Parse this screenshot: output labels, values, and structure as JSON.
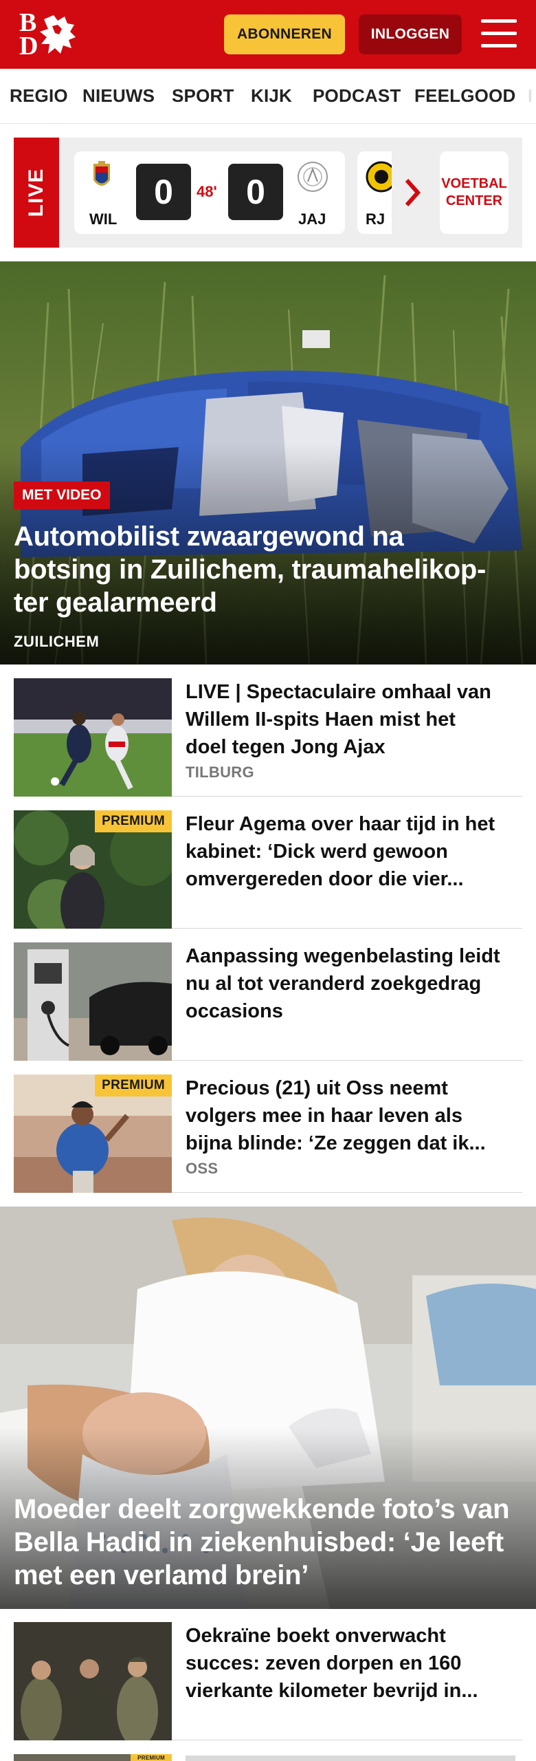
{
  "header": {
    "logo_letter_top": "B",
    "logo_letter_bottom": "D",
    "subscribe_label": "ABONNEREN",
    "login_label": "INLOGGEN",
    "menu_icon": "hamburger-icon",
    "brand_color": "#d10a11",
    "subscribe_color": "#f8c437"
  },
  "nav": {
    "items": [
      "REGIO",
      "NIEUWS",
      "SPORT",
      "KIJK",
      "PODCAST",
      "FEELGOOD",
      "I"
    ]
  },
  "live": {
    "label": "LIVE",
    "match": {
      "home_code": "WIL",
      "home_score": "0",
      "minute": "48'",
      "away_score": "0",
      "away_code": "JAJ"
    },
    "next_team_code": "RJ",
    "center_label_line1": "VOETBAL",
    "center_label_line2": "CENTER"
  },
  "hero": {
    "badge": "MET VIDEO",
    "title_lines": [
      "Automobilist zwaargewond na",
      "botsing in Zuilichem, traumahelikop-",
      "ter gealarmeerd"
    ],
    "location": "ZUILICHEM"
  },
  "articles": [
    {
      "title_lines": [
        "LIVE | Spectaculaire omhaal van",
        "Willem II-spits Haen mist het",
        "doel tegen Jong Ajax"
      ],
      "location": "TILBURG",
      "premium": ""
    },
    {
      "title_lines": [
        "Fleur Agema over haar tijd in het",
        "kabinet: ‘Dick werd gewoon",
        "omvergereden door die vier..."
      ],
      "location": "",
      "premium": "PREMIUM"
    },
    {
      "title_lines": [
        "Aanpassing wegenbelasting leidt",
        "nu al tot veranderd zoekgedrag",
        "occasions"
      ],
      "location": "",
      "premium": ""
    },
    {
      "title_lines": [
        "Precious (21) uit Oss neemt",
        "volgers mee in haar leven als",
        "bijna blinde: ‘Ze zeggen dat ik..."
      ],
      "location": "OSS",
      "premium": "PREMIUM"
    }
  ],
  "hero2": {
    "title_lines": [
      "Moeder deelt zorgwekkende foto’s van",
      "Bella Hadid in ziekenhuisbed: ‘Je leeft",
      "met een verlamd brein’"
    ]
  },
  "articles2": [
    {
      "title_lines": [
        "Oekraïne boekt onverwacht",
        "succes: zeven dorpen en 160",
        "vierkante kilometer bevrijd in..."
      ],
      "premium": ""
    },
    {
      "premium": "PREMIUM"
    }
  ]
}
